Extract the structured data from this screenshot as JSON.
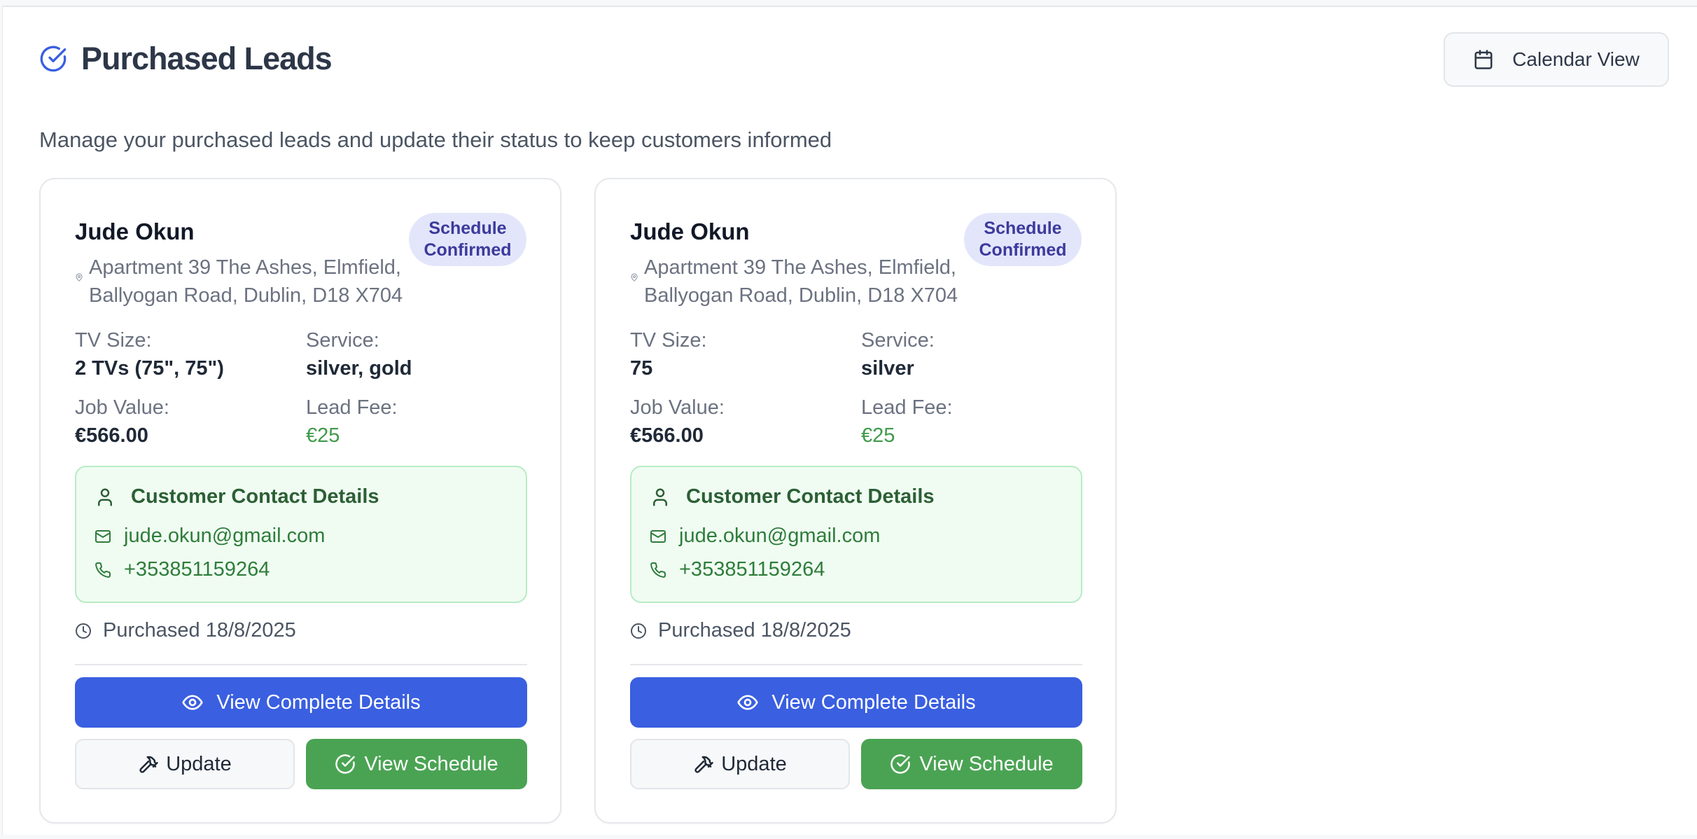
{
  "header": {
    "title": "Purchased Leads",
    "icon": "check-circle-icon",
    "calendar_button": "Calendar View",
    "subtitle": "Manage your purchased leads and update their status to keep customers informed"
  },
  "colors": {
    "primary": "#3a5fe0",
    "success": "#4aa353",
    "badge_bg": "#e3e6fb",
    "badge_text": "#3c3a9c",
    "contact_bg": "#f0fcf2"
  },
  "leads": [
    {
      "name": "Jude Okun",
      "status": "Schedule Confirmed",
      "address": "Apartment 39 The Ashes, Elmfield, Ballyogan Road, Dublin, D18 X704",
      "tv_size_label": "TV Size:",
      "tv_size": "2 TVs (75\", 75\")",
      "service_label": "Service:",
      "service": "silver, gold",
      "job_value_label": "Job Value:",
      "job_value": "€566.00",
      "lead_fee_label": "Lead Fee:",
      "lead_fee": "€25",
      "contact_title": "Customer Contact Details",
      "email": "jude.okun@gmail.com",
      "phone": "+353851159264",
      "purchased": "Purchased 18/8/2025",
      "view_details": "View Complete Details",
      "update": "Update",
      "view_schedule": "View Schedule"
    },
    {
      "name": "Jude Okun",
      "status": "Schedule Confirmed",
      "address": "Apartment 39 The Ashes, Elmfield, Ballyogan Road, Dublin, D18 X704",
      "tv_size_label": "TV Size:",
      "tv_size": "75",
      "service_label": "Service:",
      "service": "silver",
      "job_value_label": "Job Value:",
      "job_value": "€566.00",
      "lead_fee_label": "Lead Fee:",
      "lead_fee": "€25",
      "contact_title": "Customer Contact Details",
      "email": "jude.okun@gmail.com",
      "phone": "+353851159264",
      "purchased": "Purchased 18/8/2025",
      "view_details": "View Complete Details",
      "update": "Update",
      "view_schedule": "View Schedule"
    }
  ]
}
